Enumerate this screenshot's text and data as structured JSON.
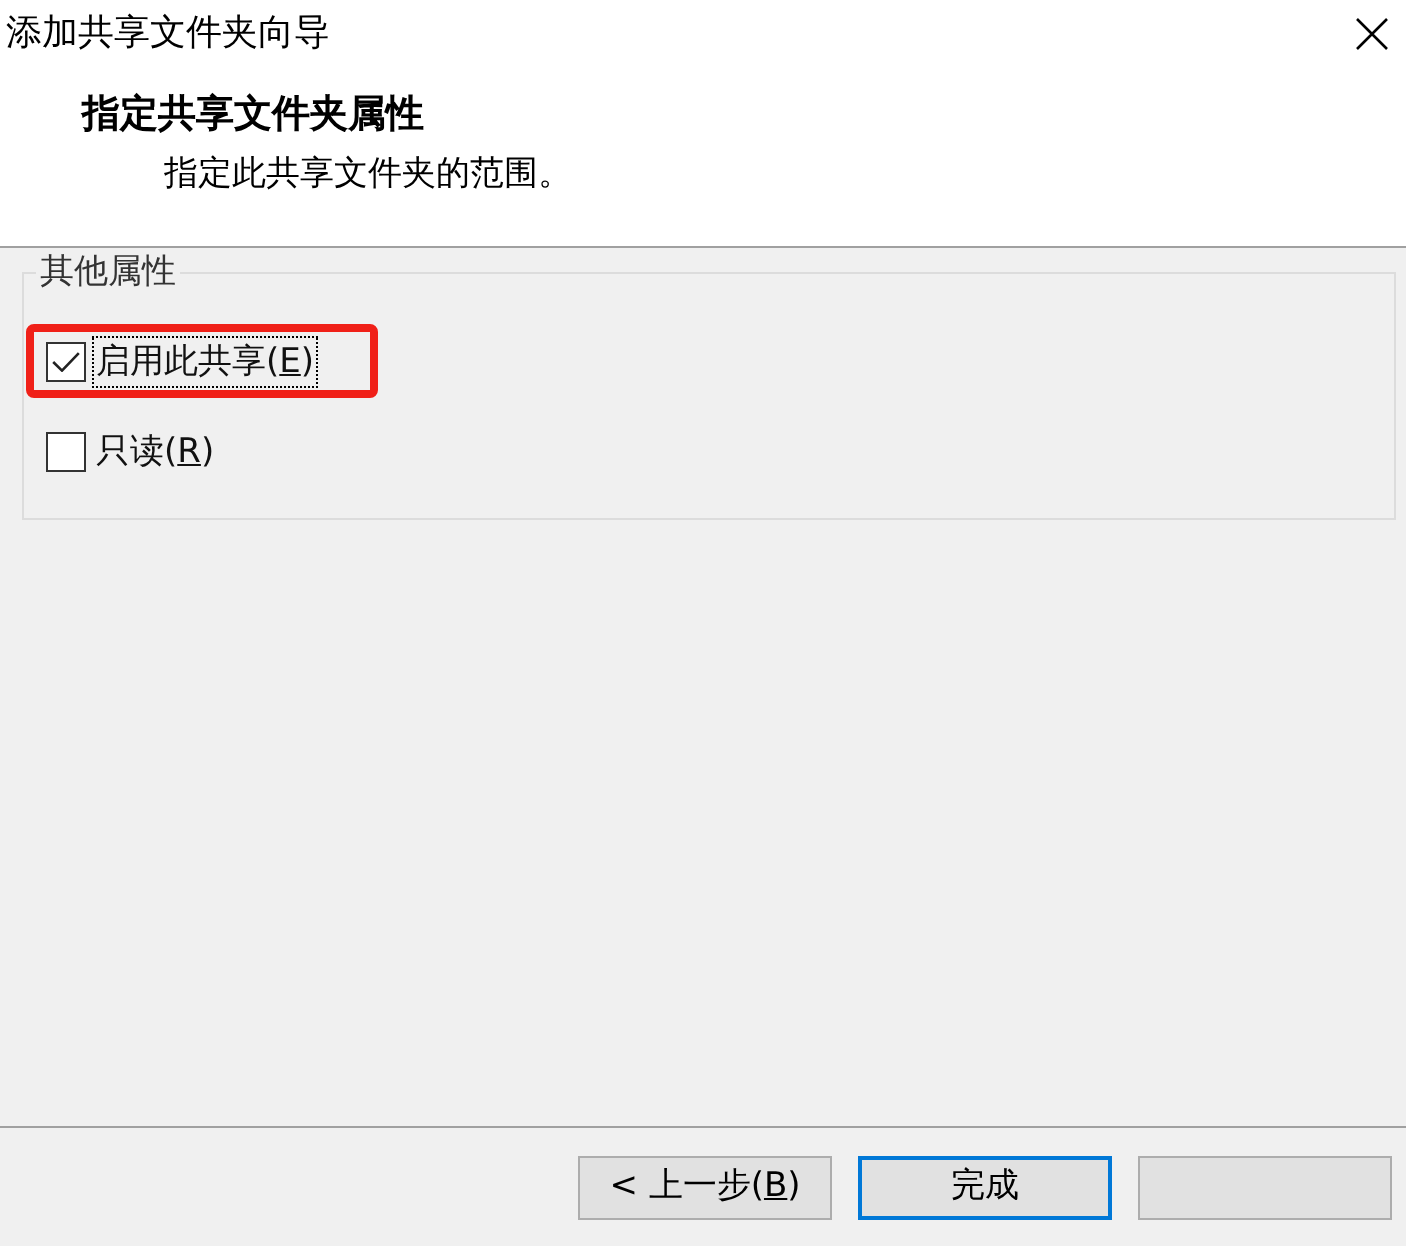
{
  "window": {
    "title": "添加共享文件夹向导"
  },
  "header": {
    "title": "指定共享文件夹属性",
    "subtitle": "指定此共享文件夹的范围。"
  },
  "group": {
    "legend": "其他属性",
    "options": [
      {
        "label": "启用此共享(",
        "access_key": "E",
        "label_end": ")",
        "checked": true,
        "focused": true,
        "highlighted": true
      },
      {
        "label": "只读(",
        "access_key": "R",
        "label_end": ")",
        "checked": false,
        "focused": false,
        "highlighted": false
      }
    ]
  },
  "buttons": [
    {
      "label": "< 上一步(",
      "access_key": "B",
      "label_end": ")",
      "default": false
    },
    {
      "label": "完成",
      "default": true
    },
    {
      "default": false
    }
  ]
}
